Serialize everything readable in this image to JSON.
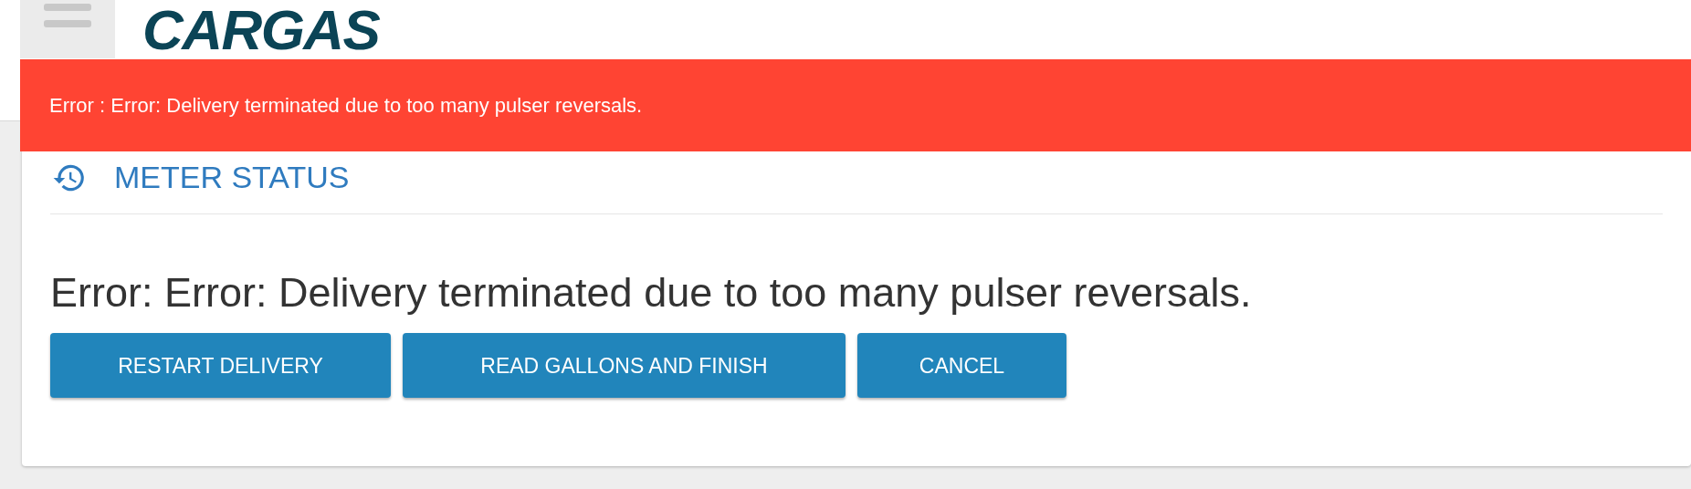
{
  "header": {
    "logo": "CARGAS"
  },
  "alert": {
    "message": "Error : Error: Delivery terminated due to too many pulser reversals."
  },
  "card": {
    "title": "METER STATUS",
    "message": "Error: Error: Delivery terminated due to too many pulser reversals.",
    "buttons": [
      {
        "label": "RESTART DELIVERY"
      },
      {
        "label": "READ GALLONS AND FINISH"
      },
      {
        "label": "CANCEL"
      }
    ]
  }
}
